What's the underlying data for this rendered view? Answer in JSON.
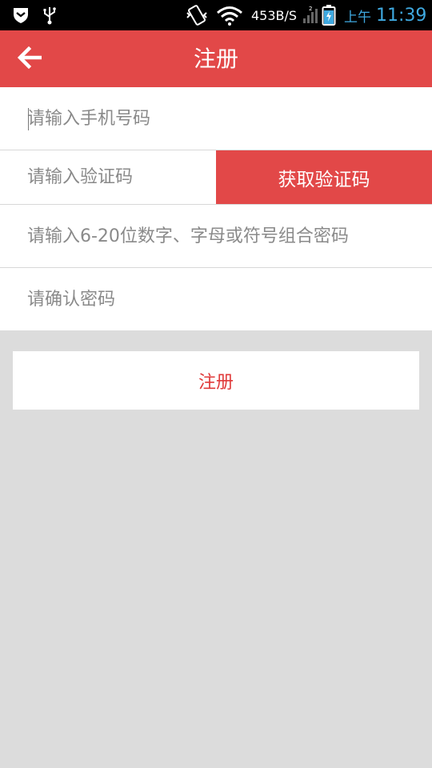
{
  "status_bar": {
    "network_speed": "453B/S",
    "ampm": "上午",
    "time": "11:39",
    "icons": [
      "shield-icon",
      "usb-icon",
      "vibrate-icon",
      "wifi-icon",
      "signal-icon",
      "battery-charging-icon"
    ]
  },
  "header": {
    "title": "注册",
    "back_icon": "arrow-left-icon"
  },
  "form": {
    "phone": {
      "value": "",
      "placeholder": "请输入手机号码"
    },
    "code": {
      "value": "",
      "placeholder": "请输入验证码"
    },
    "get_code_label": "获取验证码",
    "password": {
      "value": "",
      "placeholder": "请输入6-20位数字、字母或符号组合密码"
    },
    "confirm_password": {
      "value": "",
      "placeholder": "请确认密码"
    }
  },
  "register_label": "注册",
  "colors": {
    "accent": "#e24848",
    "register_text": "#e03a3a",
    "background": "#dcdcdc",
    "clock": "#3fa9e0"
  }
}
